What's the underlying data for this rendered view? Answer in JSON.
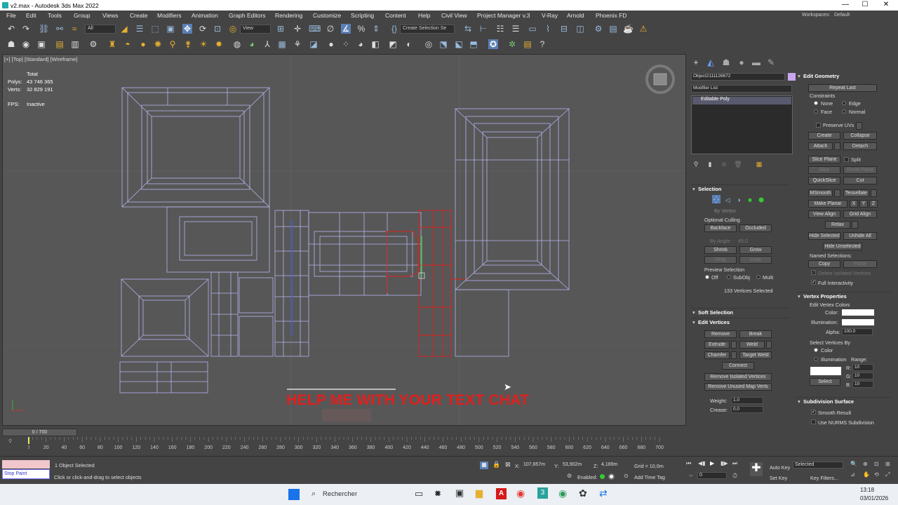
{
  "window": {
    "title": "v2.max - Autodesk 3ds Max 2022",
    "min": "—",
    "max": "☐",
    "close": "✕"
  },
  "menu": [
    "File",
    "Edit",
    "Tools",
    "Group",
    "Views",
    "Create",
    "Modifiers",
    "Animation",
    "Graph Editors",
    "Rendering",
    "Customize",
    "Scripting",
    "Content",
    "Help",
    "Civil View",
    "Project Manager v.3",
    "V-Ray",
    "Arnold",
    "Phoenix FD"
  ],
  "workspaces": {
    "label": "Workspaces:",
    "value": "Default"
  },
  "toolbar": {
    "filter": "All",
    "view": "View",
    "selection_set": "Create Selection Se"
  },
  "viewport": {
    "label": "[+] [Top] [Standard] [Wireframe]",
    "stats": {
      "total": "Total",
      "polys_label": "Polys:",
      "polys": "43 746 365",
      "verts_label": "Verts:",
      "verts": "32 829 191",
      "fps_label": "FPS:",
      "fps": "Inactive"
    },
    "overlay_text": "HELP ME WITH YOUR TEXT CHAT"
  },
  "command_panel": {
    "object_name": "Object2111126672",
    "modifier_list": "Modifier List",
    "stack_item": "Editable Poly",
    "selection": {
      "header": "Selection",
      "by_vertex": "By Vertex",
      "optional_culling": "Optional Culling",
      "backface": "Backface",
      "occluded": "Occluded",
      "by_angle": "By Angle:",
      "angle": "45.0",
      "shrink": "Shrink",
      "grow": "Grow",
      "ring": "Ring",
      "loop": "Loop",
      "preview": "Preview Selection",
      "off": "Off",
      "subobj": "SubObj",
      "multi": "Multi",
      "status": "133 Vertices Selected"
    },
    "soft_selection": "Soft Selection",
    "edit_vertices": {
      "header": "Edit Vertices",
      "remove": "Remove",
      "break": "Break",
      "extrude": "Extrude",
      "weld": "Weld",
      "chamfer": "Chamfer",
      "target_weld": "Target Weld",
      "connect": "Connect",
      "remove_isolated": "Remove Isolated Vertices",
      "remove_unused": "Remove Unused Map Verts",
      "weight_label": "Weight:",
      "weight": "1.0",
      "crease_label": "Crease:",
      "crease": "0.0"
    },
    "edit_geometry": {
      "header": "Edit Geometry",
      "repeat_last": "Repeat Last",
      "constraints": "Constraints",
      "none": "None",
      "edge": "Edge",
      "face": "Face",
      "normal": "Normal",
      "preserve_uvs": "Preserve UVs",
      "create": "Create",
      "collapse": "Collapse",
      "attach": "Attach",
      "detach": "Detach",
      "slice_plane": "Slice Plane",
      "split": "Split",
      "slice": "Slice",
      "reset_plane": "Reset Plane",
      "quickslice": "QuickSlice",
      "cut": "Cut",
      "msmooth": "MSmooth",
      "tessellate": "Tessellate",
      "make_planar": "Make Planar",
      "x": "X",
      "y": "Y",
      "z": "Z",
      "view_align": "View Align",
      "grid_align": "Grid Align",
      "relax": "Relax",
      "hide_selected": "Hide Selected",
      "unhide_all": "Unhide All",
      "hide_unselected": "Hide Unselected",
      "named_selections": "Named Selections:",
      "copy": "Copy",
      "paste": "Paste",
      "delete_isolated": "Delete Isolated Vertices",
      "full_interactivity": "Full Interactivity"
    },
    "vertex_properties": {
      "header": "Vertex Properties",
      "edit_colors": "Edit Vertex Colors",
      "color_label": "Color:",
      "illum_label": "Illumination:",
      "alpha_label": "Alpha:",
      "alpha": "100.0",
      "select_by": "Select Vertices By",
      "color_opt": "Color",
      "illum_opt": "Illumination",
      "range": "Range:",
      "r_label": "R:",
      "g_label": "G:",
      "b_label": "B:",
      "r": "10",
      "g": "10",
      "b": "10",
      "select": "Select"
    },
    "subdivision": {
      "header": "Subdivision Surface",
      "smooth_result": "Smooth Result",
      "use_nurms": "Use NURMS Subdivision"
    }
  },
  "timeline": {
    "frame": "0 / 700",
    "ticks": [
      "0",
      "20",
      "40",
      "60",
      "80",
      "100",
      "120",
      "140",
      "160",
      "180",
      "200",
      "220",
      "240",
      "260",
      "280",
      "300",
      "320",
      "340",
      "360",
      "380",
      "400",
      "420",
      "440",
      "460",
      "480",
      "500",
      "520",
      "540",
      "560",
      "580",
      "600",
      "620",
      "640",
      "660",
      "680",
      "700"
    ]
  },
  "status": {
    "script_label": "Stop Paint",
    "selected": "1 Object Selected",
    "prompt": "Click or click-and-drag to select objects",
    "x_label": "X:",
    "x": "107,857m",
    "y_label": "Y:",
    "y": "53,902m",
    "z_label": "Z:",
    "z": "4,189m",
    "grid": "Grid = 10,0m",
    "enabled": "Enabled:",
    "add_time_tag": "Add Time Tag",
    "auto_key": "Auto Key",
    "set_key": "Set Key",
    "key_mode": "Selected",
    "key_filters": "Key Filters...",
    "frame_val": "0"
  },
  "taskbar": {
    "search": "Rechercher",
    "time": "13:18",
    "date": "03/01/2026"
  },
  "colors": {
    "selected_red": "#e0201e",
    "wire": "#b4b4f0",
    "accent": "#6aa5ff"
  }
}
